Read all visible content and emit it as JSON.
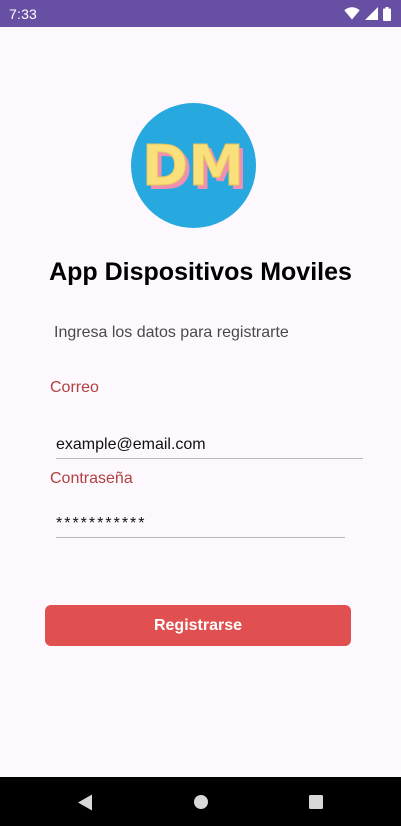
{
  "status_bar": {
    "time": "7:33",
    "icons": [
      "wifi-icon",
      "signal-icon",
      "battery-icon"
    ],
    "color": "#6750a4"
  },
  "logo": {
    "text": "DM",
    "background_color": "#27a9e0",
    "letter_color": "#f9e07a",
    "shadow_color": "#ef8fb2"
  },
  "app_title": "App Dispositivos Moviles",
  "subtitle": "Ingresa los datos para registrarte",
  "form": {
    "email_label": "Correo",
    "email_value": "example@email.com",
    "password_label": "Contraseña",
    "password_value": "***********"
  },
  "register_button": {
    "label": "Registrarse",
    "color": "#e05050"
  },
  "nav_bar": {
    "icons": [
      "back-icon",
      "home-icon",
      "recents-icon"
    ]
  }
}
